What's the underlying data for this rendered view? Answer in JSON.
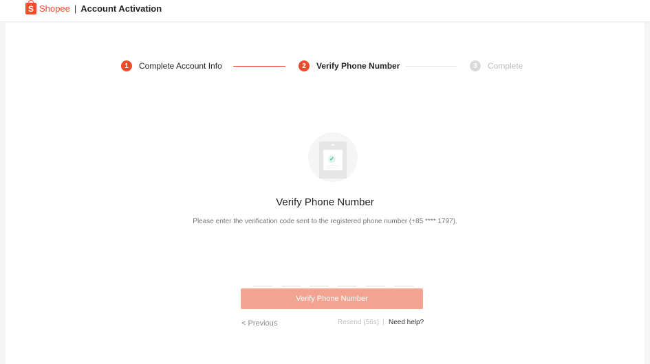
{
  "header": {
    "logo_letter": "S",
    "brand": "Shopee",
    "separator": "|",
    "title": "Account Activation"
  },
  "steps": [
    {
      "number": "1",
      "label": "Complete Account Info",
      "state": "done"
    },
    {
      "number": "2",
      "label": "Verify Phone Number",
      "state": "current"
    },
    {
      "number": "3",
      "label": "Complete",
      "state": "pending"
    }
  ],
  "illustration": {
    "icon": "phone-check-icon",
    "check_glyph": "✓"
  },
  "main": {
    "title": "Verify Phone Number",
    "description": "Please enter the verification code sent to the registered phone number (+85 **** 1797).",
    "code_slots": [
      "",
      "",
      "",
      "",
      "",
      ""
    ],
    "verify_button": "Verify Phone Number",
    "previous_link": "< Previous",
    "resend": "Resend (56s)",
    "help_separator": "|",
    "help_link": "Need help?"
  },
  "colors": {
    "brand": "#ee4d2d",
    "button_disabled": "#f3a391",
    "step_inactive": "#d9d9d9"
  }
}
